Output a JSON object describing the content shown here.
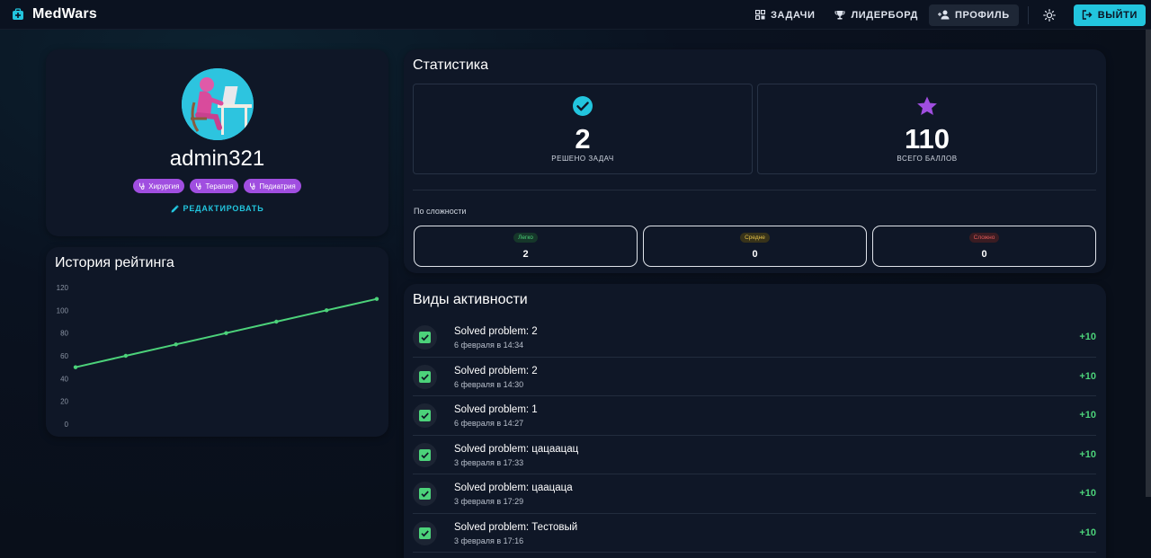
{
  "app": {
    "name": "MedWars"
  },
  "nav": {
    "tasks": "ЗАДАЧИ",
    "leaderboard": "ЛИДЕРБОРД",
    "profile": "ПРОФИЛЬ",
    "logout": "ВЫЙТИ"
  },
  "profile": {
    "username": "admin321",
    "tags": [
      "Хирургия",
      "Терапия",
      "Педиатрия"
    ],
    "edit_label": "РЕДАКТИРОВАТЬ"
  },
  "rating_history": {
    "title": "История рейтинга"
  },
  "chart_data": {
    "type": "line",
    "title": "История рейтинга",
    "xlabel": "",
    "ylabel": "",
    "ylim": [
      0,
      120
    ],
    "yticks": [
      "0",
      "20",
      "40",
      "60",
      "80",
      "100",
      "120"
    ],
    "grid": false,
    "series": [
      {
        "values": [
          50,
          60,
          70,
          80,
          90,
          100,
          110
        ]
      }
    ]
  },
  "stats": {
    "title": "Статистика",
    "solved_value": "2",
    "solved_label": "РЕШЕНО ЗАДАЧ",
    "points_value": "110",
    "points_label": "ВСЕГО БАЛЛОВ",
    "difficulty_title": "По сложности",
    "difficulty": [
      {
        "label": "Легко",
        "value": "2",
        "color": "#4cd27a"
      },
      {
        "label": "Средне",
        "value": "0",
        "color": "#e3c04a"
      },
      {
        "label": "Сложно",
        "value": "0",
        "color": "#e05a5a"
      }
    ]
  },
  "activities": {
    "title": "Виды активности",
    "items": [
      {
        "title": "Solved problem: 2",
        "time": "6 февраля в 14:34",
        "points": "+10"
      },
      {
        "title": "Solved problem: 2",
        "time": "6 февраля в 14:30",
        "points": "+10"
      },
      {
        "title": "Solved problem: 1",
        "time": "6 февраля в 14:27",
        "points": "+10"
      },
      {
        "title": "Solved problem: цацаацац",
        "time": "3 февраля в 17:33",
        "points": "+10"
      },
      {
        "title": "Solved problem: цаацаца",
        "time": "3 февраля в 17:29",
        "points": "+10"
      },
      {
        "title": "Solved problem: Тестовый",
        "time": "3 февраля в 17:16",
        "points": "+10"
      }
    ]
  },
  "colors": {
    "accent": "#22c5de",
    "tag": "#a04ee0",
    "success": "#4cd27a",
    "star": "#a04ee0"
  }
}
